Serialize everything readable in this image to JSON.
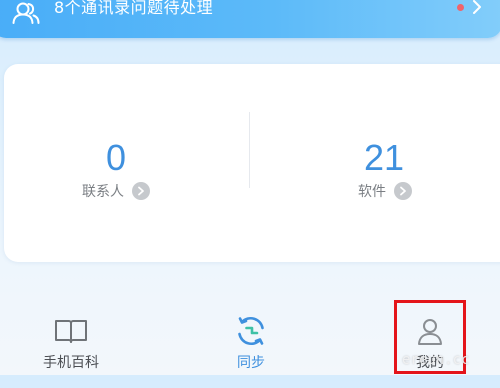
{
  "banner": {
    "icon": "contacts-icon",
    "text": "8个通讯录问题待处理",
    "dot_color": "#f0646b",
    "chevron": "chevron-right-icon"
  },
  "stats": {
    "contacts": {
      "count": "0",
      "label": "联系人"
    },
    "apps": {
      "count": "21",
      "label": "软件"
    }
  },
  "nav": {
    "items": [
      {
        "label": "手机百科",
        "icon": "book-icon"
      },
      {
        "label": "同步",
        "icon": "sync-icon"
      },
      {
        "label": "我的",
        "icon": "profile-icon"
      }
    ]
  },
  "watermark": "ereun.cc",
  "colors": {
    "accent": "#3f90de",
    "banner": "#49adf8",
    "highlight": "#e4141a"
  }
}
